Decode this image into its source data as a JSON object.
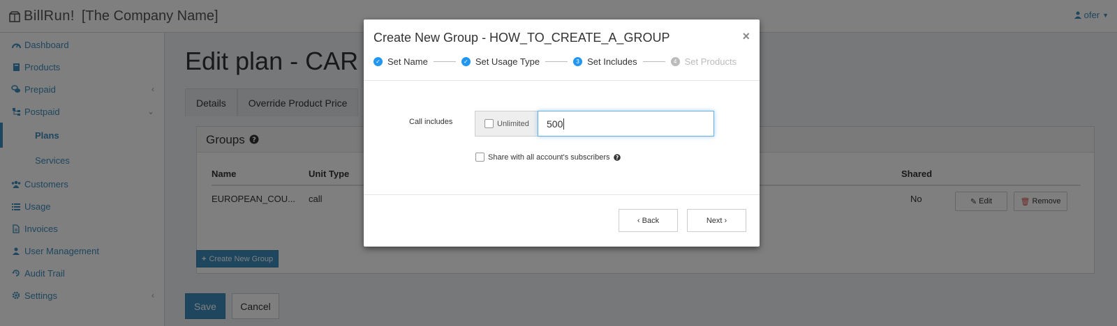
{
  "header": {
    "brand": "BillRun!",
    "company": "[The Company Name]",
    "user": "ofer"
  },
  "sidebar": {
    "items": [
      {
        "label": "Dashboard",
        "icon": "dashboard-icon"
      },
      {
        "label": "Products",
        "icon": "book-icon"
      },
      {
        "label": "Prepaid",
        "icon": "coins-icon",
        "caret": "‹"
      },
      {
        "label": "Postpaid",
        "icon": "sitemap-icon",
        "caret": "⌄"
      },
      {
        "label": "Plans",
        "icon": ""
      },
      {
        "label": "Services",
        "icon": ""
      },
      {
        "label": "Customers",
        "icon": "users-icon"
      },
      {
        "label": "Usage",
        "icon": "list-icon"
      },
      {
        "label": "Invoices",
        "icon": "file-icon"
      },
      {
        "label": "User Management",
        "icon": "user-icon"
      },
      {
        "label": "Audit Trail",
        "icon": "history-icon"
      },
      {
        "label": "Settings",
        "icon": "gear-icon",
        "caret": "‹"
      }
    ]
  },
  "main": {
    "title": "Edit plan - CAR",
    "tabs": [
      {
        "label": "Details"
      },
      {
        "label": "Override Product Price"
      }
    ],
    "groups": {
      "title": "Groups",
      "columns": {
        "name": "Name",
        "unit_type": "Unit Type",
        "shared": "Shared"
      },
      "rows": [
        {
          "name": "EUROPEAN_COU...",
          "unit_type": "call",
          "shared": "No"
        }
      ],
      "edit_label": "Edit",
      "remove_label": "Remove"
    },
    "create_group_label": "Create New Group",
    "save_label": "Save",
    "cancel_label": "Cancel"
  },
  "modal": {
    "title": "Create New Group - HOW_TO_CREATE_A_GROUP",
    "close": "×",
    "steps": [
      {
        "label": "Set Name",
        "state": "done",
        "marker": "✓"
      },
      {
        "label": "Set Usage Type",
        "state": "done",
        "marker": "✓"
      },
      {
        "label": "Set Includes",
        "state": "current",
        "marker": "3"
      },
      {
        "label": "Set Products",
        "state": "pending",
        "marker": "4"
      }
    ],
    "field_label": "Call includes",
    "unlimited_label": "Unlimited",
    "unlimited_checked": false,
    "includes_value": "500",
    "share_label": "Share with all account's subscribers",
    "share_checked": false,
    "back_label": "‹ Back",
    "next_label": "Next ›"
  },
  "colors": {
    "accent": "#3c8dbc",
    "step_active": "#2196f3",
    "backdrop": "rgba(0,0,0,0.5)"
  }
}
